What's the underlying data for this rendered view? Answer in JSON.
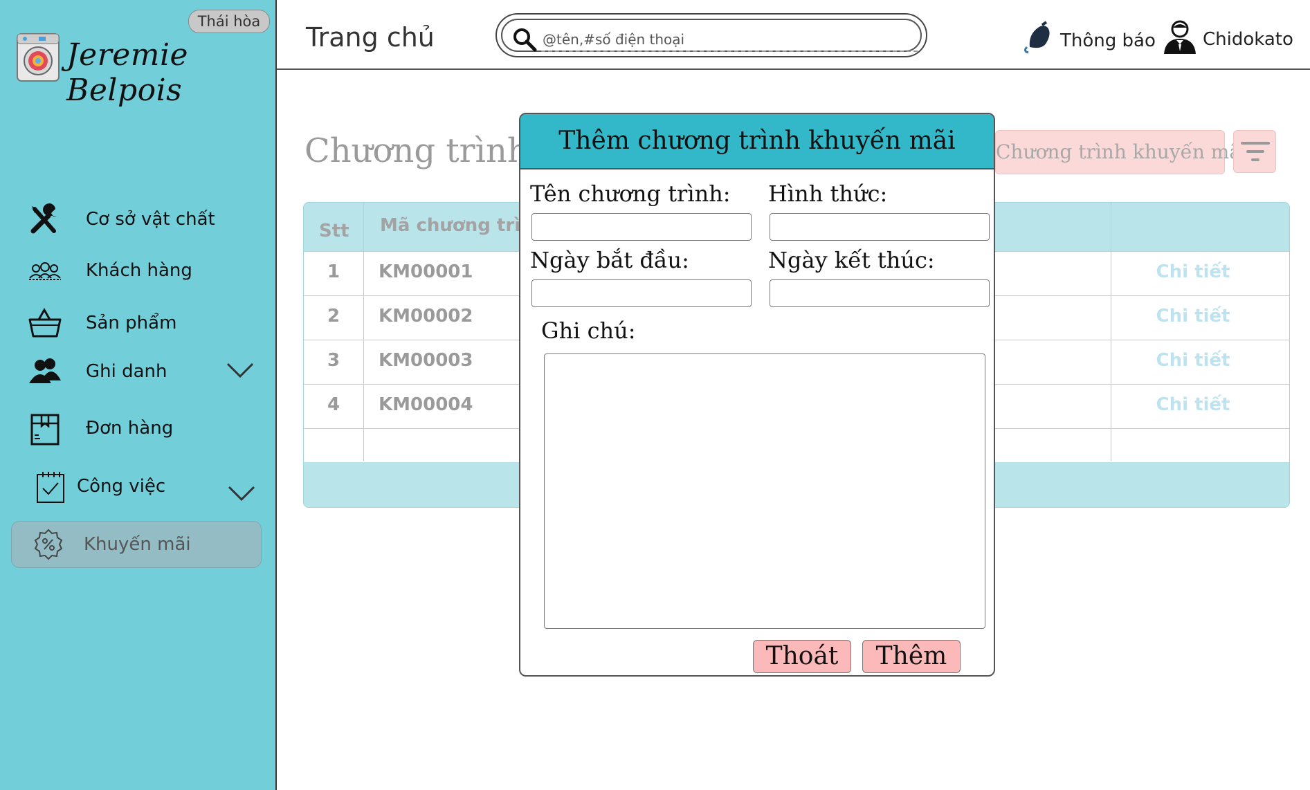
{
  "sidebar": {
    "branch_badge": "Thái hòa",
    "brand_name": "Jeremie Belpois",
    "items": [
      {
        "label": "Cơ sở vật chất",
        "icon": "tools-icon"
      },
      {
        "label": "Khách hàng",
        "icon": "customers-icon"
      },
      {
        "label": "Sản phẩm",
        "icon": "basket-icon"
      },
      {
        "label": "Ghi danh",
        "icon": "users-icon"
      },
      {
        "label": "Đơn hàng",
        "icon": "order-box-icon"
      },
      {
        "label": "Công việc",
        "icon": "calendar-check-icon"
      },
      {
        "label": "Khuyến mãi",
        "icon": "discount-badge-icon",
        "active": true
      }
    ]
  },
  "header": {
    "title": "Trang chủ",
    "search_placeholder": "@tên,#số điện thoại",
    "notification_label": "Thông báo",
    "user_name": "Chidokato"
  },
  "main": {
    "section_title": "Chương trình k",
    "add_button_label": "Chương trình khuyến mãi",
    "table": {
      "columns": [
        "Stt",
        "Mã chương trình"
      ],
      "rows": [
        {
          "stt": "1",
          "code": "KM00001",
          "detail": "Chi tiết"
        },
        {
          "stt": "2",
          "code": "KM00002",
          "detail": "Chi tiết"
        },
        {
          "stt": "3",
          "code": "KM00003",
          "detail": "Chi tiết"
        },
        {
          "stt": "4",
          "code": "KM00004",
          "detail": "Chi tiết"
        }
      ]
    }
  },
  "modal": {
    "title": "Thêm chương trình khuyến mãi",
    "name_label": "Tên chương trình:",
    "type_label": "Hình thức:",
    "start_label": "Ngày bắt đầu:",
    "end_label": "Ngày kết thúc:",
    "note_label": "Ghi chú:",
    "exit_label": "Thoát",
    "add_label": "Thêm"
  },
  "colors": {
    "sidebar_bg": "#72cfda",
    "modal_header": "#32b8c8",
    "button_pink": "#fbb9b9",
    "table_header": "#b9e4ea"
  }
}
